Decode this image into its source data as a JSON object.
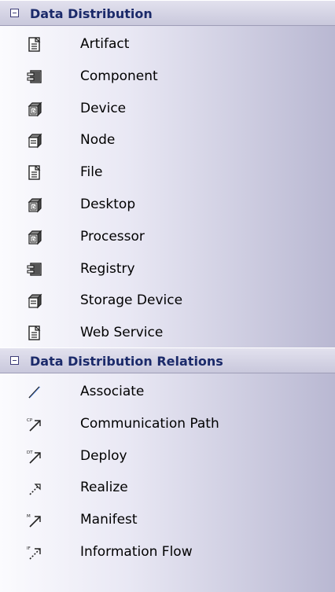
{
  "sections": [
    {
      "title": "Data Distribution",
      "items": [
        {
          "label": "Artifact",
          "icon": "artifact-icon"
        },
        {
          "label": "Component",
          "icon": "component-icon"
        },
        {
          "label": "Device",
          "icon": "device-icon"
        },
        {
          "label": "Node",
          "icon": "node-icon"
        },
        {
          "label": "File",
          "icon": "artifact-icon"
        },
        {
          "label": "Desktop",
          "icon": "device-icon"
        },
        {
          "label": "Processor",
          "icon": "device-icon"
        },
        {
          "label": "Registry",
          "icon": "component-icon"
        },
        {
          "label": "Storage Device",
          "icon": "node-icon"
        },
        {
          "label": "Web Service",
          "icon": "artifact-icon"
        }
      ]
    },
    {
      "title": "Data Distribution Relations",
      "items": [
        {
          "label": "Associate",
          "icon": "associate-icon"
        },
        {
          "label": "Communication Path",
          "icon": "communication-path-icon",
          "icon_text": "CP"
        },
        {
          "label": "Deploy",
          "icon": "deploy-icon",
          "icon_text": "DT"
        },
        {
          "label": "Realize",
          "icon": "realize-icon"
        },
        {
          "label": "Manifest",
          "icon": "manifest-icon",
          "icon_text": "M"
        },
        {
          "label": "Information Flow",
          "icon": "information-flow-icon",
          "icon_text": "IF"
        }
      ]
    }
  ],
  "colors": {
    "header_text": "#1b2a6a",
    "panel_light": "#fbfbfe",
    "panel_dark": "#b9b8d2"
  }
}
